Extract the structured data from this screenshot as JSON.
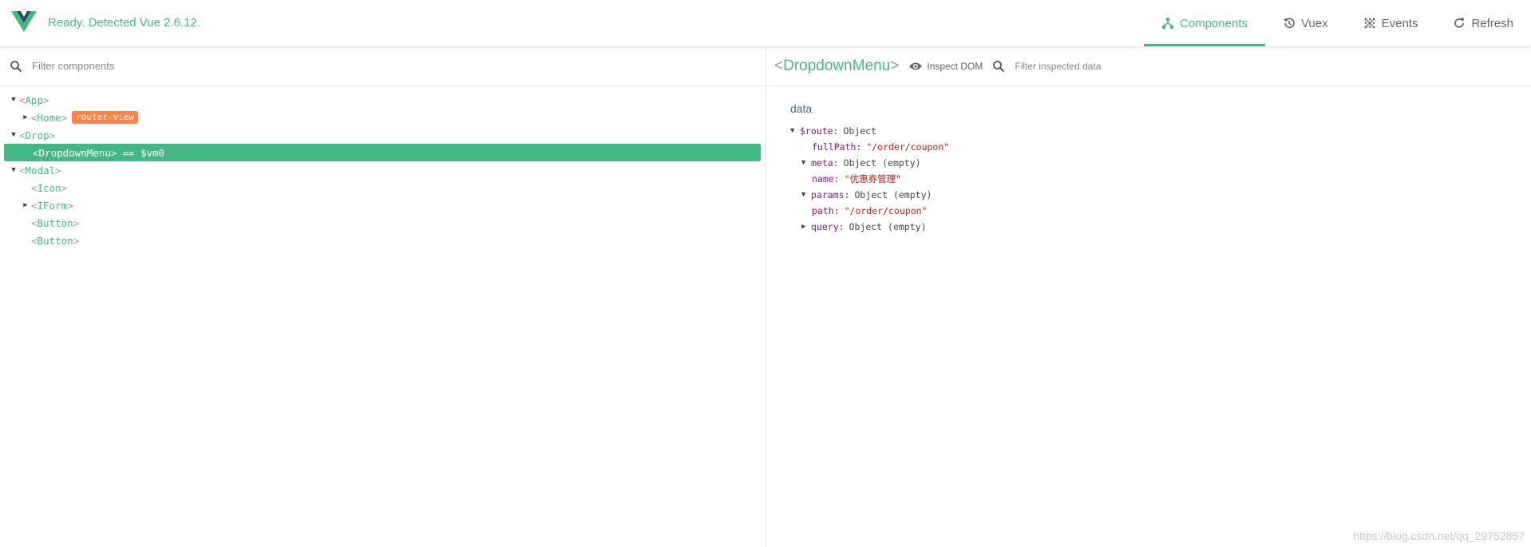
{
  "header": {
    "status": "Ready. Detected Vue 2.6.12.",
    "nav": [
      {
        "label": "Components",
        "icon": "components-icon"
      },
      {
        "label": "Vuex",
        "icon": "history-icon"
      },
      {
        "label": "Events",
        "icon": "events-icon"
      },
      {
        "label": "Refresh",
        "icon": "refresh-icon"
      }
    ]
  },
  "left": {
    "filter_placeholder": "Filter components",
    "tree": [
      {
        "name": "App",
        "expanded": true,
        "depth": 0
      },
      {
        "name": "Home",
        "expanded": false,
        "depth": 1,
        "badge": "router-view"
      },
      {
        "name": "Drop",
        "expanded": true,
        "depth": 0
      },
      {
        "name": "DropdownMenu",
        "depth": 1,
        "selected": true,
        "vm": "== $vm0"
      },
      {
        "name": "Modal",
        "expanded": true,
        "depth": 0
      },
      {
        "name": "Icon",
        "depth": 1
      },
      {
        "name": "IForm",
        "expanded": false,
        "depth": 1
      },
      {
        "name": "Button",
        "depth": 1
      },
      {
        "name": "Button",
        "depth": 1
      }
    ]
  },
  "right": {
    "component_name": "DropdownMenu",
    "inspect_dom": "Inspect DOM",
    "filter_placeholder": "Filter inspected data",
    "section_title": "data",
    "rows": [
      {
        "key": "$route",
        "value": "Object",
        "type": "obj",
        "depth": 0,
        "arrow": "down"
      },
      {
        "key": "fullPath",
        "value": "\"/order/coupon\"",
        "type": "str",
        "depth": 1
      },
      {
        "key": "meta",
        "value": "Object (empty)",
        "type": "obj",
        "depth": 1,
        "arrow": "down"
      },
      {
        "key": "name",
        "value": "\"优惠券管理\"",
        "type": "str",
        "depth": 1
      },
      {
        "key": "params",
        "value": "Object (empty)",
        "type": "obj",
        "depth": 1,
        "arrow": "down"
      },
      {
        "key": "path",
        "value": "\"/order/coupon\"",
        "type": "str",
        "depth": 1
      },
      {
        "key": "query",
        "value": "Object (empty)",
        "type": "obj",
        "depth": 1,
        "arrow": "right"
      }
    ]
  },
  "watermark": "https://blog.csdn.net/qq_29752857",
  "colors": {
    "accent": "#42b983",
    "badge": "#ff8344",
    "key": "#881391",
    "string": "#c41a16"
  }
}
